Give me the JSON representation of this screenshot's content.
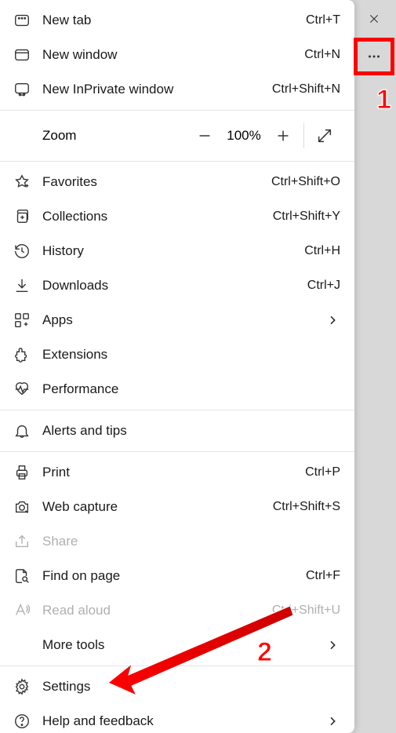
{
  "menu": {
    "new_tab": {
      "label": "New tab",
      "shortcut": "Ctrl+T"
    },
    "new_window": {
      "label": "New window",
      "shortcut": "Ctrl+N"
    },
    "new_inprivate": {
      "label": "New InPrivate window",
      "shortcut": "Ctrl+Shift+N"
    },
    "zoom": {
      "label": "Zoom",
      "value": "100%"
    },
    "favorites": {
      "label": "Favorites",
      "shortcut": "Ctrl+Shift+O"
    },
    "collections": {
      "label": "Collections",
      "shortcut": "Ctrl+Shift+Y"
    },
    "history": {
      "label": "History",
      "shortcut": "Ctrl+H"
    },
    "downloads": {
      "label": "Downloads",
      "shortcut": "Ctrl+J"
    },
    "apps": {
      "label": "Apps"
    },
    "extensions": {
      "label": "Extensions"
    },
    "performance": {
      "label": "Performance"
    },
    "alerts": {
      "label": "Alerts and tips"
    },
    "print": {
      "label": "Print",
      "shortcut": "Ctrl+P"
    },
    "web_capture": {
      "label": "Web capture",
      "shortcut": "Ctrl+Shift+S"
    },
    "share": {
      "label": "Share"
    },
    "find": {
      "label": "Find on page",
      "shortcut": "Ctrl+F"
    },
    "read_aloud": {
      "label": "Read aloud",
      "shortcut": "Ctrl+Shift+U"
    },
    "more_tools": {
      "label": "More tools"
    },
    "settings": {
      "label": "Settings"
    },
    "help": {
      "label": "Help and feedback"
    }
  },
  "annotations": {
    "step1": "1",
    "step2": "2"
  }
}
